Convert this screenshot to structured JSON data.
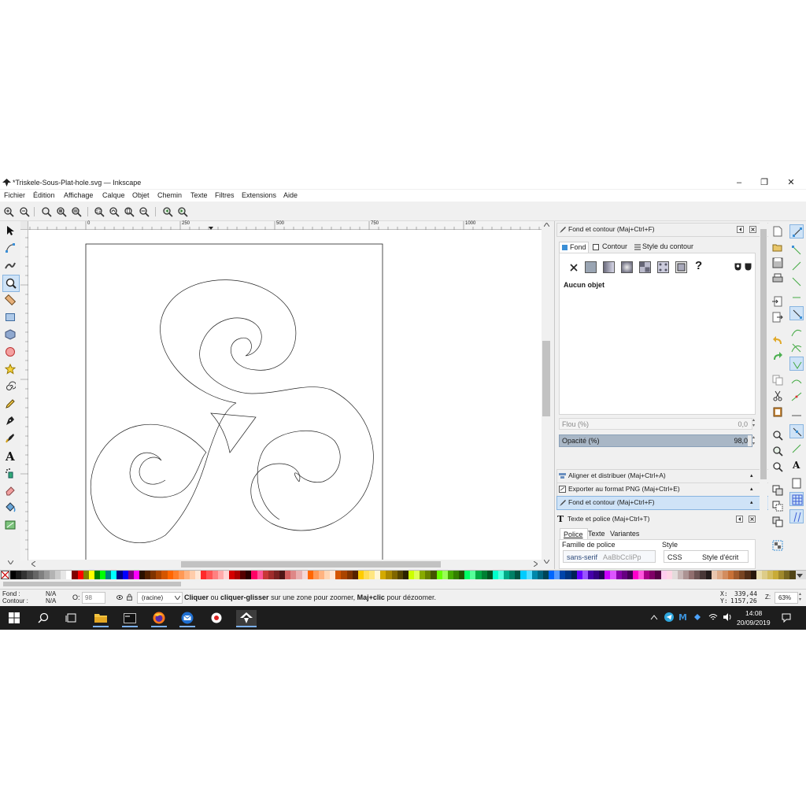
{
  "window": {
    "title": "*Triskele-Sous-Plat-hole.svg — Inkscape",
    "controls": [
      "–",
      "❐",
      "✕"
    ]
  },
  "menu": [
    "Fichier",
    "Édition",
    "Affichage",
    "Calque",
    "Objet",
    "Chemin",
    "Texte",
    "Filtres",
    "Extensions",
    "Aide"
  ],
  "ruler": {
    "labels": [
      "0",
      "250",
      "500",
      "750",
      "1000"
    ]
  },
  "fill_stroke_panel": {
    "title": "Fond et contour (Maj+Ctrl+F)",
    "tabs": [
      "Fond",
      "Contour",
      "Style du contour"
    ],
    "no_object": "Aucun objet",
    "paint_question": "?",
    "blur_label": "Flou (%)",
    "blur_value": "0,0",
    "opacity_label": "Opacité (%)",
    "opacity_value": "98,0"
  },
  "collapsed_panels": [
    "Aligner et distribuer (Maj+Ctrl+A)",
    "Exporter au format PNG (Maj+Ctrl+E)",
    "Fond et contour (Maj+Ctrl+F)"
  ],
  "text_panel": {
    "title": "Texte et police (Maj+Ctrl+T)",
    "tabs": [
      "Police",
      "Texte",
      "Variantes"
    ],
    "family_label": "Famille de police",
    "family_value": "sans-serif",
    "family_preview": "AaBbCcIiPp",
    "style_label": "Style",
    "style_value": "CSS",
    "style_written": "Style d'écrit"
  },
  "status": {
    "fill_label": "Fond :",
    "fill_value": "N/A",
    "stroke_label": "Contour :",
    "stroke_value": "N/A",
    "opacity_label": "O:",
    "opacity_value": "98",
    "layer": "(racine)",
    "message_b1": "Cliquer",
    "message_t1": " ou ",
    "message_b2": "cliquer-glisser",
    "message_t2": " sur une zone pour zoomer, ",
    "message_b3": "Maj+clic",
    "message_t3": " pour dézoomer.",
    "x_label": "X:",
    "x_value": "339,44",
    "y_label": "Y:",
    "y_value": "1157,26",
    "zoom_label": "Z:",
    "zoom_value": "63%"
  },
  "taskbar": {
    "time": "14:08",
    "date": "20/09/2019"
  },
  "colors": {
    "accent": "#3b8fd6",
    "swatches": [
      "#000000",
      "#1a1a1a",
      "#333333",
      "#4d4d4d",
      "#666666",
      "#808080",
      "#999999",
      "#b3b3b3",
      "#cccccc",
      "#e6e6e6",
      "#ffffff",
      "#800000",
      "#ff0000",
      "#808000",
      "#ffff00",
      "#008000",
      "#00ff00",
      "#008080",
      "#00ffff",
      "#000080",
      "#0000ff",
      "#800080",
      "#ff00ff",
      "#2b1100",
      "#552200",
      "#803300",
      "#aa4400",
      "#d45500",
      "#ff6600",
      "#ff7f2a",
      "#ff9955",
      "#ffb380",
      "#ffccaa",
      "#ffe6d5",
      "#ff2a2a",
      "#ff5555",
      "#ff8080",
      "#ffaaaa",
      "#ffd5d5",
      "#d40000",
      "#aa0000",
      "#550000",
      "#2b0000",
      "#ff0066",
      "#ff5599",
      "#c83737",
      "#a02c2c",
      "#782121",
      "#501616",
      "#d35f5f",
      "#de8787",
      "#e9afaf",
      "#f4d7d7",
      "#ff6600",
      "#ff9955",
      "#ffb380",
      "#ffd5b3",
      "#ffe6d5",
      "#d45500",
      "#aa4400",
      "#803300",
      "#552200",
      "#ffcc00",
      "#ffdd55",
      "#ffe680",
      "#fff6d5",
      "#d4aa00",
      "#aa8800",
      "#806600",
      "#554400",
      "#2b2200",
      "#ccff00",
      "#ddff55",
      "#88aa00",
      "#668000",
      "#445500",
      "#66ff00",
      "#99ff55",
      "#44aa00",
      "#338000",
      "#225500",
      "#00ff66",
      "#55ff99",
      "#00aa44",
      "#008033",
      "#005522",
      "#00ffcc",
      "#55ffdd",
      "#00aa88",
      "#008066",
      "#005544",
      "#00ccff",
      "#55ddff",
      "#0088aa",
      "#006680",
      "#004455",
      "#0066ff",
      "#5599ff",
      "#0044aa",
      "#003380",
      "#002255",
      "#6600ff",
      "#9955ff",
      "#4400aa",
      "#330080",
      "#220055",
      "#cc00ff",
      "#dd55ff",
      "#8800aa",
      "#660080",
      "#440055",
      "#ff00cc",
      "#ff55dd",
      "#aa0088",
      "#800066",
      "#550044",
      "#ffccee",
      "#ffd5e5",
      "#e3dbdb",
      "#c8b7b7",
      "#ac9393",
      "#916f6f",
      "#6c5353",
      "#483737",
      "#241c1c",
      "#e9c6af",
      "#deaa87",
      "#d38d5f",
      "#c87137",
      "#a05a2c",
      "#784421",
      "#502d16",
      "#28170b",
      "#e9ddaf",
      "#ddcc88",
      "#d3bc5f",
      "#c8ab37",
      "#a0892c",
      "#786721",
      "#504416"
    ]
  }
}
